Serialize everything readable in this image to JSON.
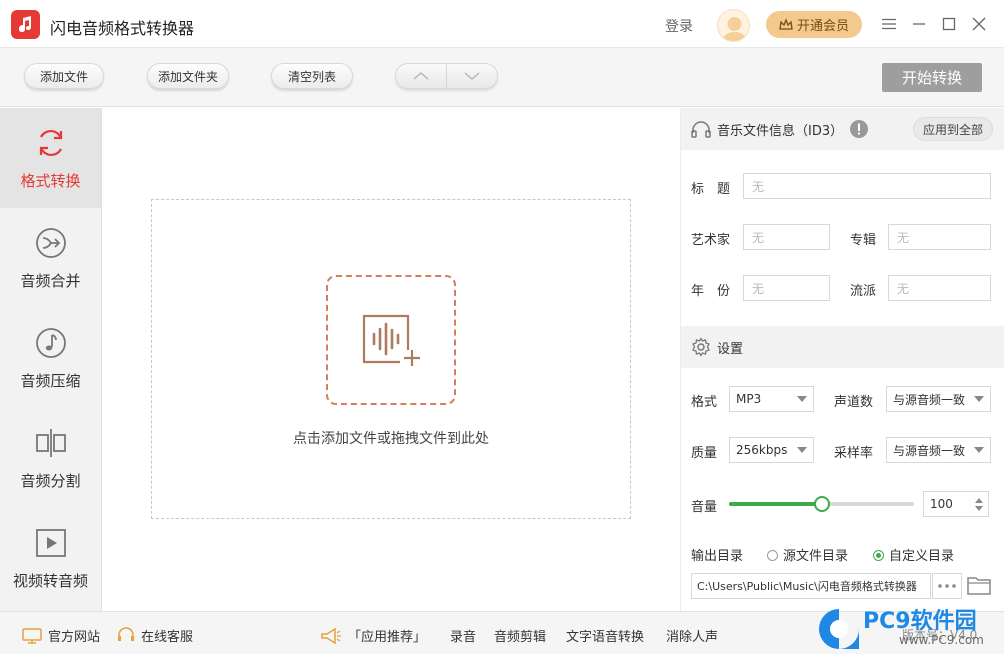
{
  "titlebar": {
    "app_title": "闪电音频格式转换器",
    "login": "登录",
    "vip": "开通会员"
  },
  "toolbar": {
    "add_file": "添加文件",
    "add_folder": "添加文件夹",
    "clear_list": "清空列表",
    "start": "开始转换"
  },
  "sidebar": {
    "items": [
      {
        "label": "格式转换",
        "icon": "refresh-icon",
        "active": true
      },
      {
        "label": "音频合并",
        "icon": "merge-icon"
      },
      {
        "label": "音频压缩",
        "icon": "music-note-icon"
      },
      {
        "label": "音频分割",
        "icon": "split-icon"
      },
      {
        "label": "视频转音频",
        "icon": "video-play-icon"
      }
    ]
  },
  "main": {
    "drop_text": "点击添加文件或拖拽文件到此处"
  },
  "id3": {
    "title": "音乐文件信息（ID3）",
    "apply_all": "应用到全部",
    "fields": {
      "title_label": "标　题",
      "artist_label": "艺术家",
      "album_label": "专辑",
      "year_label": "年　份",
      "genre_label": "流派",
      "placeholder": "无"
    }
  },
  "settings": {
    "title": "设置",
    "format_label": "格式",
    "format_value": "MP3",
    "channels_label": "声道数",
    "channels_value": "与源音频一致",
    "quality_label": "质量",
    "quality_value": "256kbps",
    "samplerate_label": "采样率",
    "samplerate_value": "与源音频一致",
    "volume_label": "音量",
    "volume_value": "100",
    "volume_fraction": 0.5,
    "output_label": "输出目录",
    "source_dir": "源文件目录",
    "custom_dir": "自定义目录",
    "output_path": "C:\\Users\\Public\\Music\\闪电音频格式转换器"
  },
  "footer": {
    "website": "官方网站",
    "support": "在线客服",
    "recommend": "「应用推荐」",
    "links": [
      "录音",
      "音频剪辑",
      "文字语音转换",
      "消除人声"
    ],
    "version": "版本号：V4.0"
  },
  "watermark": {
    "brand": "PC9软件园",
    "url": "www.PC9.com"
  },
  "colors": {
    "accent_red": "#e53935",
    "green": "#3daa4e",
    "vip_gold": "#f3c98e"
  }
}
